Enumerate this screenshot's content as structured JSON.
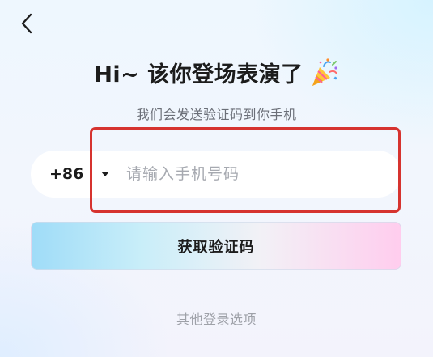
{
  "header": {
    "back_icon": "chevron-left-icon"
  },
  "hero": {
    "title": "Hi~ 该你登场表演了",
    "title_icon": "party-popper-icon",
    "subtitle": "我们会发送验证码到你手机"
  },
  "phone_form": {
    "country_code": "+86",
    "country_code_icon": "caret-down-icon",
    "phone_placeholder": "请输入手机号码",
    "phone_value": ""
  },
  "actions": {
    "get_code_label": "获取验证码",
    "other_login_label": "其他登录选项"
  },
  "colors": {
    "highlight_border": "#d6332f",
    "button_gradient_start": "#9fdcf8",
    "button_gradient_end": "#ffcdee",
    "title_text": "#1c1c1c",
    "muted_text": "#9ea1a8"
  }
}
